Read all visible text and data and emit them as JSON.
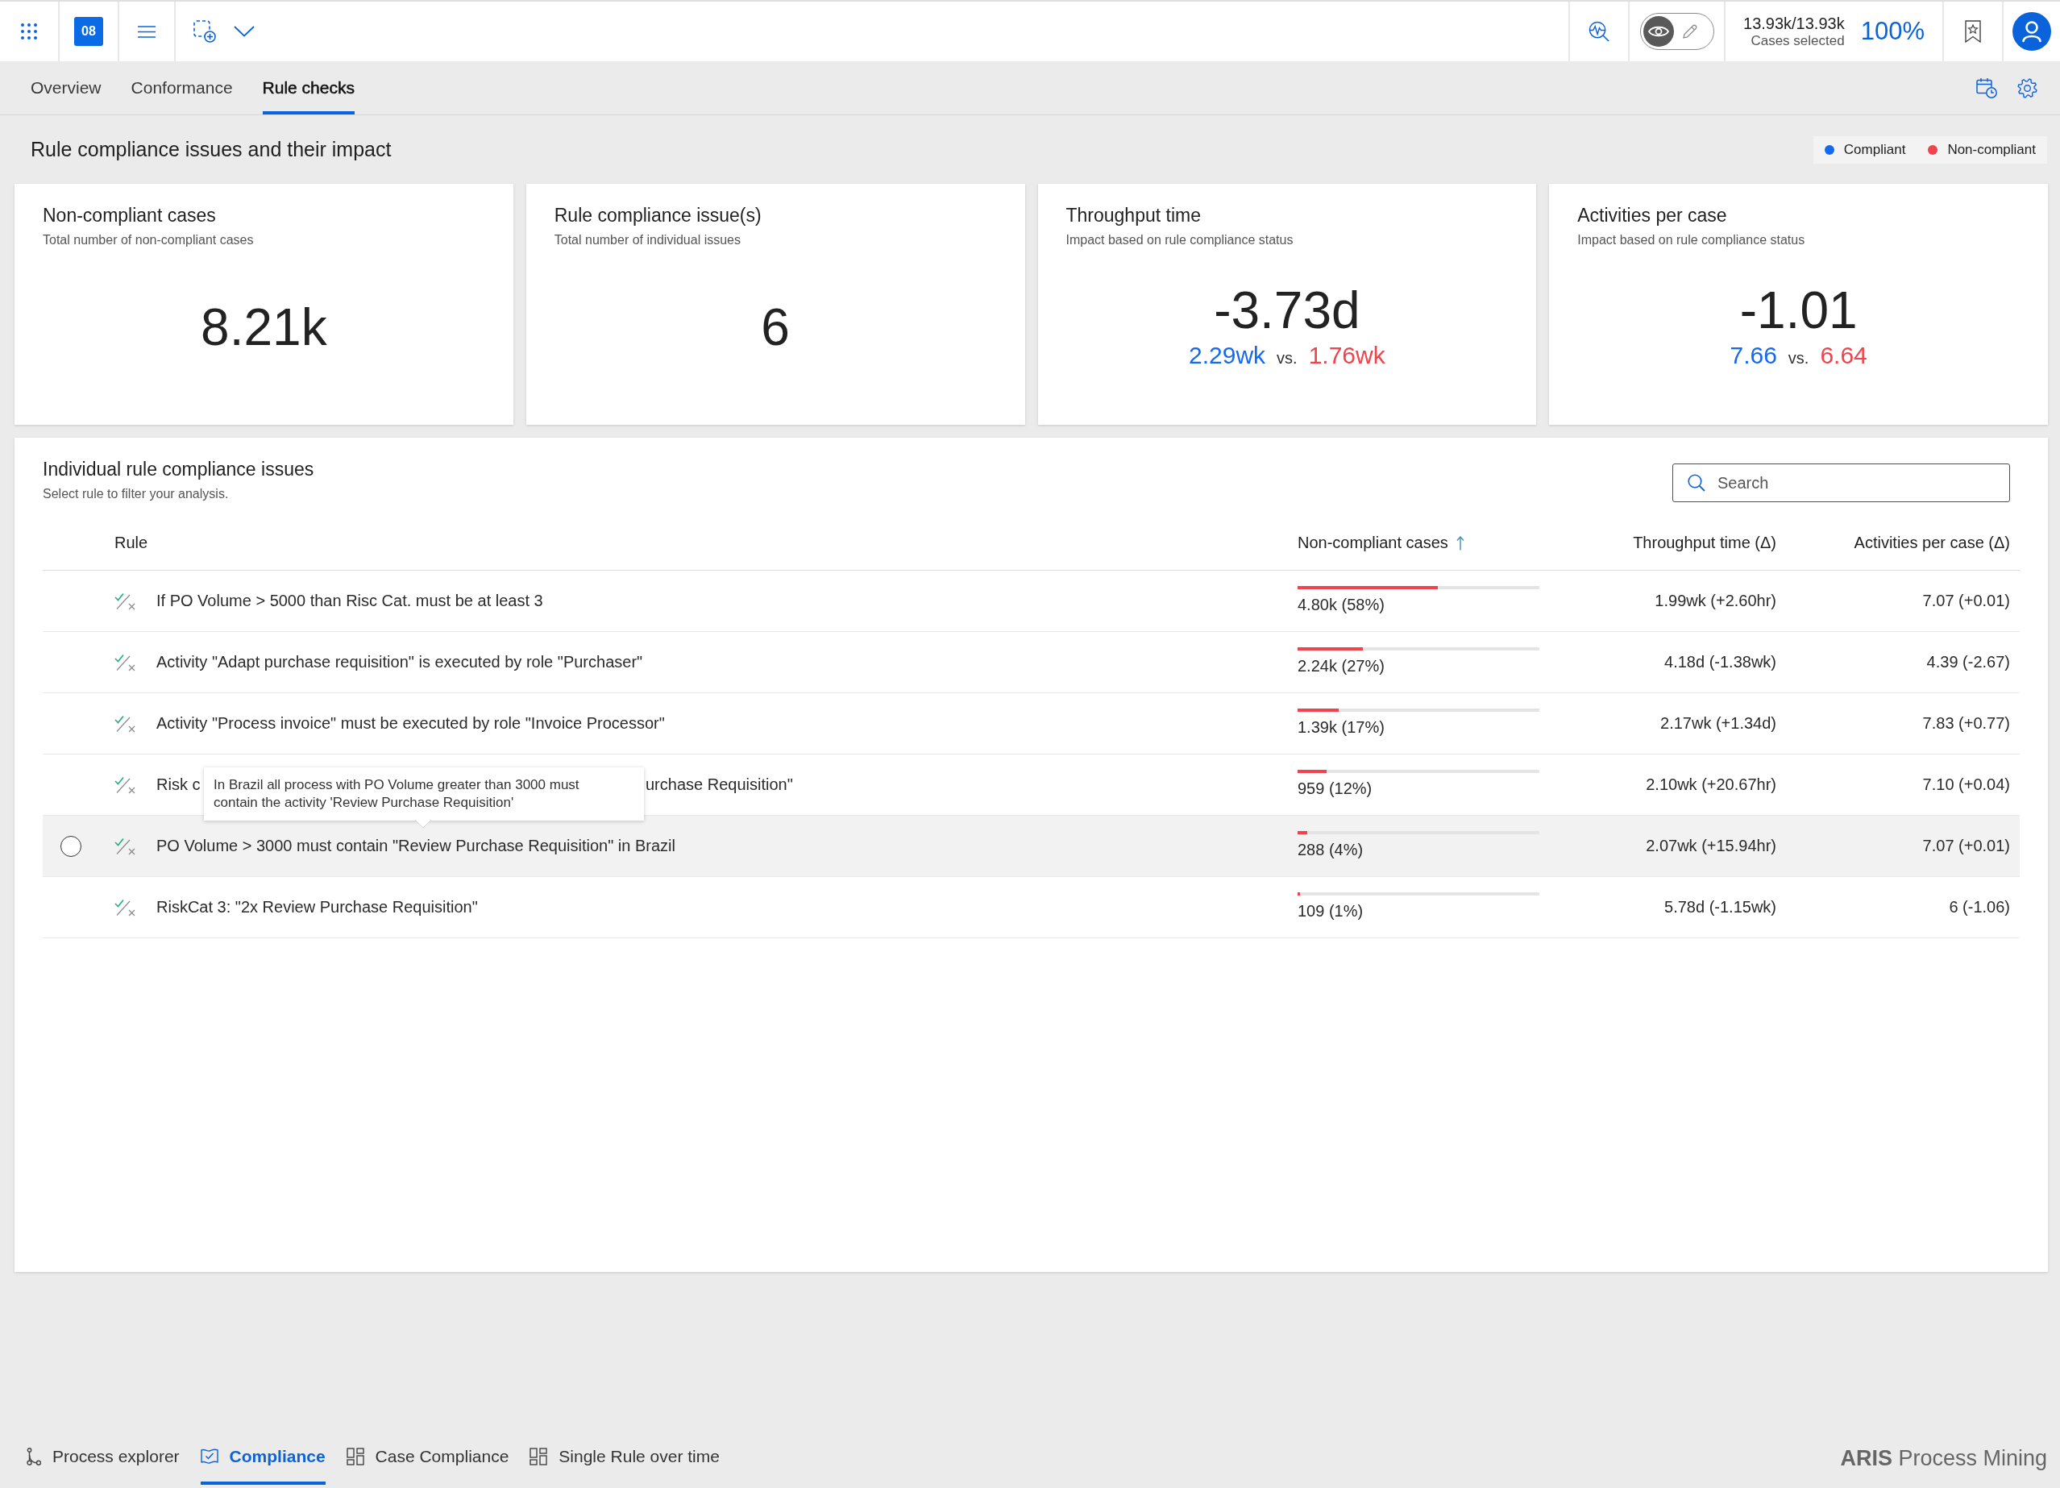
{
  "topbar": {
    "badge": "08",
    "view_toggle": [
      {
        "kind": "view",
        "selected": true
      },
      {
        "kind": "edit",
        "selected": false
      }
    ],
    "cases_selected": "13.93k/13.93k",
    "cases_label": "Cases selected",
    "selection_share": "100%"
  },
  "tabs": [
    {
      "label": "Overview",
      "selected": false
    },
    {
      "label": "Conformance",
      "selected": false
    },
    {
      "label": "Rule checks",
      "selected": true
    }
  ],
  "page_title": "Rule compliance issues and their impact",
  "legend": [
    {
      "label": "Compliant",
      "color": "#1569ef"
    },
    {
      "label": "Non-compliant",
      "color": "#f0434d"
    }
  ],
  "kpi_cards": [
    {
      "title": "Non-compliant cases",
      "subtitle": "Total number of non-compliant cases",
      "value": "8.21k"
    },
    {
      "title": "Rule compliance issue(s)",
      "subtitle": "Total number of individual issues",
      "value": "6"
    },
    {
      "title": "Throughput time",
      "subtitle": "Impact based on rule compliance status",
      "value": "-3.73d",
      "comparison": {
        "compliant": "2.29wk",
        "separator": "vs.",
        "non_compliant": "1.76wk"
      }
    },
    {
      "title": "Activities per case",
      "subtitle": "Impact based on rule compliance status",
      "value": "-1.01",
      "comparison": {
        "compliant": "7.66",
        "separator": "vs.",
        "non_compliant": "6.64"
      }
    }
  ],
  "rule_table": {
    "title": "Individual rule compliance issues",
    "subtitle": "Select rule to filter your analysis.",
    "search": {
      "placeholder": "Search"
    },
    "columns": [
      {
        "label": "Rule",
        "sorted": false
      },
      {
        "label": "Non-compliant cases",
        "sorted": true
      },
      {
        "label": "Throughput time (Δ)",
        "sorted": false
      },
      {
        "label": "Activities per case (Δ)",
        "sorted": false
      }
    ],
    "rows": [
      {
        "rule": "If PO Volume > 5000 than Risc Cat. must be at least 3",
        "hovered": false,
        "non_compliant": "4.80k (58%)",
        "level": 0.58,
        "throughput": "1.99wk (+2.60hr)",
        "activities": "7.07 (+0.01)"
      },
      {
        "rule": "Activity \"Adapt purchase requisition\" is executed by role \"Purchaser\"",
        "hovered": false,
        "non_compliant": "2.24k (27%)",
        "level": 0.27,
        "throughput": "4.18d (-1.38wk)",
        "activities": "4.39 (-2.67)"
      },
      {
        "rule": "Activity \"Process invoice\" must be executed by role \"Invoice Processor\"",
        "hovered": false,
        "non_compliant": "1.39k (17%)",
        "level": 0.17,
        "throughput": "2.17wk (+1.34d)",
        "activities": "7.83 (+0.77)"
      },
      {
        "rule": "Risk c",
        "rule_tail": "urchase Requisition\"",
        "hovered": false,
        "non_compliant": "959 (12%)",
        "level": 0.12,
        "throughput": "2.10wk (+20.67hr)",
        "activities": "7.10 (+0.04)"
      },
      {
        "rule": "PO Volume > 3000 must contain \"Review Purchase Requisition\" in Brazil",
        "hovered": true,
        "tooltip": "In Brazil all process with PO Volume greater than 3000 must contain the activity 'Review Purchase Requisition'",
        "non_compliant": "288 (4%)",
        "level": 0.04,
        "throughput": "2.07wk (+15.94hr)",
        "activities": "7.07 (+0.01)"
      },
      {
        "rule": "RiskCat 3: \"2x Review Purchase Requisition\"",
        "hovered": false,
        "non_compliant": "109 (1%)",
        "level": 0.01,
        "throughput": "5.78d (-1.15wk)",
        "activities": "6 (-1.06)"
      }
    ]
  },
  "bottom_tabs": [
    {
      "label": "Process explorer",
      "kind": "explorer",
      "selected": false
    },
    {
      "label": "Compliance",
      "kind": "compliance",
      "selected": true
    },
    {
      "label": "Case Compliance",
      "kind": "dashboard",
      "selected": false
    },
    {
      "label": "Single Rule over time",
      "kind": "dashboard",
      "selected": false
    }
  ],
  "brand": "**ARIS** Process Mining"
}
